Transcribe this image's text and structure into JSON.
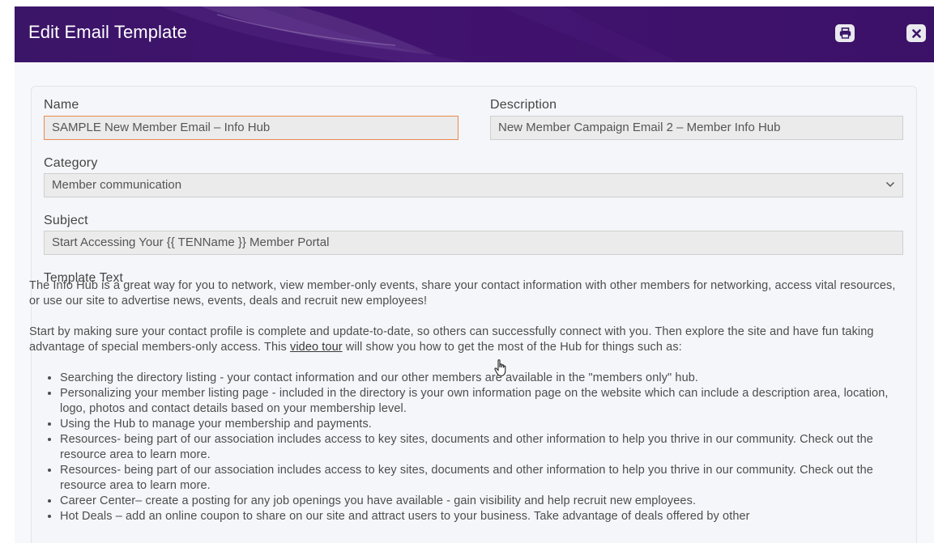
{
  "modal": {
    "title": "Edit Email Template",
    "print_icon": "print-icon",
    "close_icon": "close-icon"
  },
  "form": {
    "name_label": "Name",
    "name_value": "SAMPLE New Member Email – Info Hub",
    "description_label": "Description",
    "description_value": "New Member Campaign Email 2 – Member Info Hub",
    "category_label": "Category",
    "category_value": "Member communication",
    "subject_label": "Subject",
    "subject_value": "Start Accessing Your {{ TENName }} Member Portal",
    "template_label": "Template Text"
  },
  "template_text": {
    "para1": "The Info Hub is a great way for you to network, view member-only events, share your contact information with other members for networking, access vital resources, or use our site to advertise news, events, deals and recruit new employees!",
    "para2_before_link": "Start by making sure your contact profile is complete and update-to-date, so others can successfully connect with you. Then explore the site and have fun taking advantage of special members-only access. This ",
    "para2_link": "video tour",
    "para2_after_link": " will show you how to get the most of the Hub for things such as:",
    "bullets": [
      "Searching the directory listing - your contact information and our other members are available in the \"members only\" hub.",
      "Personalizing your member listing page - included in the directory is your own information page on the website which can include a description area, location, logo, photos and contact details based on your membership level.",
      "Using the Hub to manage your membership and payments.",
      "Resources- being part of our association includes access to key sites, documents and other information to help you thrive in our community. Check out the resource area to learn more.",
      "Resources- being part of our association includes access to key sites, documents and other information to help you thrive in our community. Check out the resource area to learn more.",
      "Career Center– create a posting for any job openings you have available - gain visibility and help recruit new employees.",
      "Hot Deals – add an online coupon to share on our site and attract users to your business. Take advantage of deals offered by other"
    ]
  },
  "colors": {
    "header_bg": "#3b1568",
    "focus_border": "#e98a4f",
    "field_bg": "#ebebeb"
  }
}
